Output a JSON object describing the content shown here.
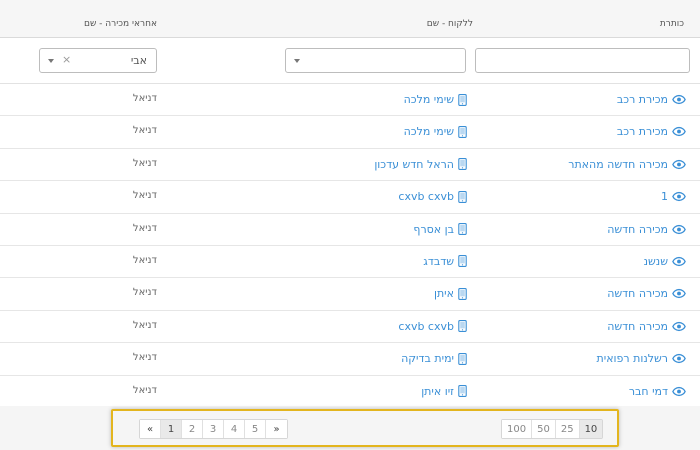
{
  "columns": {
    "title": "כותרת",
    "client": "ללקוח - שם",
    "seller": "אחראי מכירה - שם"
  },
  "filters": {
    "title_value": "",
    "client_value": "",
    "seller_value": "אבי",
    "seller_clear": "×"
  },
  "rows": [
    {
      "title": "מכירת רכב",
      "client": "שימי מלכה",
      "seller": "דניאל"
    },
    {
      "title": "מכירת רכב",
      "client": "שימי מלכה",
      "seller": "דניאל"
    },
    {
      "title": "מכירה חדשה מהאתר",
      "client": "הראל חדש עדכון",
      "seller": "דניאל"
    },
    {
      "title": "1",
      "client": "cxvb cxvb",
      "seller": "דניאל"
    },
    {
      "title": "מכירה חדשה",
      "client": "בן אסרף",
      "seller": "דניאל"
    },
    {
      "title": "שנשנ",
      "client": "שדבדג",
      "seller": "דניאל"
    },
    {
      "title": "מכירה חדשה",
      "client": "איתן",
      "seller": "דניאל"
    },
    {
      "title": "מכירה חדשה",
      "client": "cxvb cxvb",
      "seller": "דניאל"
    },
    {
      "title": "רשלנות רפואית",
      "client": "ימית בדיקה",
      "seller": "דניאל"
    },
    {
      "title": "דמי חבר",
      "client": "זיו איתן",
      "seller": "דניאל"
    }
  ],
  "pagination": {
    "prev": "«",
    "pages": [
      "1",
      "2",
      "3",
      "4",
      "5"
    ],
    "next": "»",
    "active_page": "1"
  },
  "page_sizes": {
    "options": [
      "100",
      "50",
      "25",
      "10"
    ],
    "active": "10"
  },
  "colors": {
    "link": "#3a8fd6",
    "highlight": "#e3b51e"
  }
}
